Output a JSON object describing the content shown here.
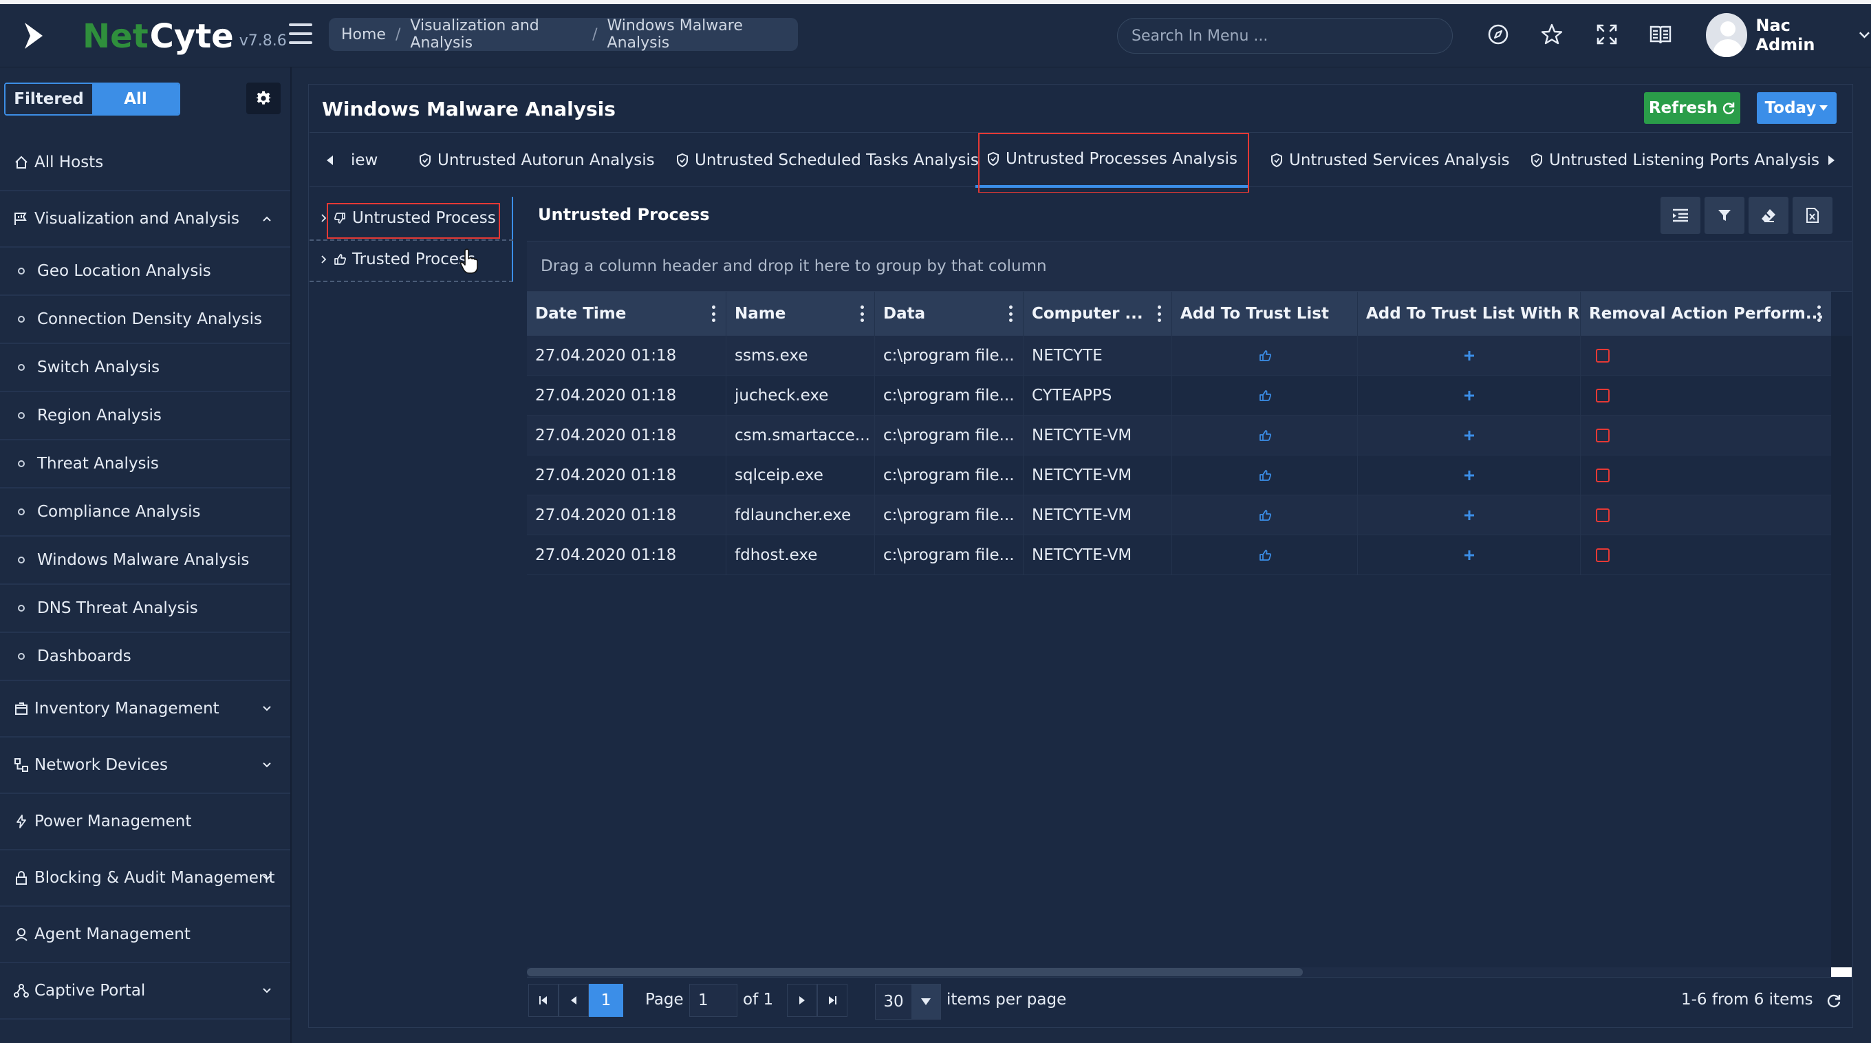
{
  "brand": {
    "part1": "Net",
    "part2": "Cyte",
    "version": "v7.8.6"
  },
  "breadcrumb": {
    "items": [
      "Home",
      "Visualization and Analysis",
      "Windows Malware Analysis"
    ],
    "separator": "/"
  },
  "search": {
    "placeholder": "Search In Menu ..."
  },
  "topicons": [
    "compass-icon",
    "star-icon",
    "fullscreen-icon",
    "book-icon"
  ],
  "user": {
    "name": "Nac Admin"
  },
  "sidebar": {
    "filter": {
      "filtered": "Filtered",
      "all": "All"
    },
    "items": [
      {
        "label": "All Hosts",
        "icon": "home-icon"
      },
      {
        "label": "Visualization and Analysis",
        "icon": "flag-chart-icon",
        "expanded": true
      },
      {
        "label": "Geo Location Analysis"
      },
      {
        "label": "Connection Density Analysis"
      },
      {
        "label": "Switch Analysis"
      },
      {
        "label": "Region Analysis"
      },
      {
        "label": "Threat Analysis"
      },
      {
        "label": "Compliance Analysis"
      },
      {
        "label": "Windows Malware Analysis"
      },
      {
        "label": "DNS Threat Analysis"
      },
      {
        "label": "Dashboards"
      },
      {
        "label": "Inventory Management",
        "icon": "inventory-icon"
      },
      {
        "label": "Network Devices",
        "icon": "network-icon"
      },
      {
        "label": "Power Management",
        "icon": "bolt-icon"
      },
      {
        "label": "Blocking & Audit Management",
        "icon": "lock-icon"
      },
      {
        "label": "Agent Management",
        "icon": "agent-icon"
      },
      {
        "label": "Captive Portal",
        "icon": "portal-icon"
      }
    ]
  },
  "page": {
    "title": "Windows Malware Analysis",
    "refresh": "Refresh",
    "today": "Today"
  },
  "tabs": [
    {
      "label": "iew"
    },
    {
      "label": "Untrusted Autorun Analysis"
    },
    {
      "label": "Untrusted Scheduled Tasks Analysis"
    },
    {
      "label": "Untrusted Processes Analysis",
      "active": true
    },
    {
      "label": "Untrusted Services Analysis"
    },
    {
      "label": "Untrusted Listening Ports Analysis"
    }
  ],
  "tree": {
    "nodes": [
      {
        "label": "Untrusted Process",
        "selected": true
      },
      {
        "label": "Trusted Process"
      }
    ]
  },
  "grid": {
    "title": "Untrusted Process",
    "group_hint": "Drag a column header and drop it here to group by that column",
    "columns": [
      "Date Time",
      "Name",
      "Data",
      "Computer ...",
      "Add To Trust List",
      "Add To Trust List With Rule",
      "Removal Action Perform..."
    ],
    "rows": [
      {
        "datetime": "27.04.2020 01:18",
        "name": "ssms.exe",
        "data": "c:\\program file...",
        "computer": "NETCYTE"
      },
      {
        "datetime": "27.04.2020 01:18",
        "name": "jucheck.exe",
        "data": "c:\\program file...",
        "computer": "CYTEAPPS"
      },
      {
        "datetime": "27.04.2020 01:18",
        "name": "csm.smartacce...",
        "data": "c:\\program file...",
        "computer": "NETCYTE-VM"
      },
      {
        "datetime": "27.04.2020 01:18",
        "name": "sqlceip.exe",
        "data": "c:\\program file...",
        "computer": "NETCYTE-VM"
      },
      {
        "datetime": "27.04.2020 01:18",
        "name": "fdlauncher.exe",
        "data": "c:\\program file...",
        "computer": "NETCYTE-VM"
      },
      {
        "datetime": "27.04.2020 01:18",
        "name": "fdhost.exe",
        "data": "c:\\program file...",
        "computer": "NETCYTE-VM"
      }
    ]
  },
  "pager": {
    "current": "1",
    "page_label": "Page",
    "page_value": "1",
    "of_label": "of 1",
    "page_size": "30",
    "items_per_page": "items per page",
    "summary": "1-6 from 6 items"
  },
  "colors": {
    "accent": "#3b8ee8",
    "success": "#2a9d49",
    "highlight": "#e53935",
    "brand_green": "#2f8f3c",
    "bg": "#1c2a42"
  }
}
